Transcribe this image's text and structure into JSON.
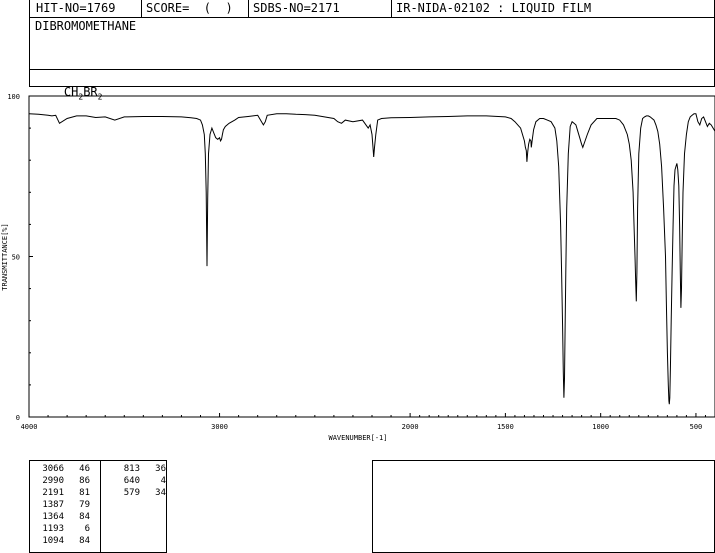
{
  "header": {
    "hit_no": "HIT-NO=1769",
    "score": "SCORE=  (  )",
    "sdbs_no": "SDBS-NO=2171",
    "ir_id": "IR-NIDA-02102 : LIQUID FILM",
    "compound_name": "DIBROMOMETHANE",
    "formula_pre": "CH",
    "formula_sub1": "2",
    "formula_mid": "BR",
    "formula_sub2": "2"
  },
  "chart_data": {
    "type": "line",
    "xlabel": "WAVENUMBER[-1]",
    "ylabel": "TRANSMITTANCE[%]",
    "xlim": [
      4000,
      400
    ],
    "ylim": [
      0,
      100
    ],
    "x_ticks": [
      4000,
      3000,
      2000,
      1500,
      1000,
      500
    ],
    "x_tick_labels": [
      "4000",
      "3000",
      "2000",
      "1500",
      "1000",
      "500"
    ],
    "y_ticks": [
      0,
      50,
      100
    ],
    "y_tick_labels": [
      "0",
      "50",
      "100"
    ],
    "x": [
      4000,
      3950,
      3900,
      3880,
      3860,
      3840,
      3800,
      3750,
      3700,
      3650,
      3600,
      3550,
      3500,
      3400,
      3300,
      3200,
      3150,
      3120,
      3100,
      3090,
      3080,
      3075,
      3070,
      3066,
      3062,
      3058,
      3050,
      3040,
      3030,
      3020,
      3010,
      3000,
      2995,
      2990,
      2985,
      2980,
      2970,
      2950,
      2920,
      2900,
      2850,
      2800,
      2780,
      2770,
      2760,
      2750,
      2700,
      2650,
      2600,
      2550,
      2500,
      2450,
      2400,
      2380,
      2360,
      2340,
      2300,
      2250,
      2220,
      2210,
      2200,
      2195,
      2191,
      2187,
      2180,
      2170,
      2150,
      2100,
      2000,
      1900,
      1800,
      1700,
      1600,
      1500,
      1470,
      1450,
      1420,
      1400,
      1395,
      1390,
      1387,
      1383,
      1378,
      1372,
      1366,
      1364,
      1360,
      1352,
      1340,
      1320,
      1300,
      1280,
      1260,
      1240,
      1230,
      1220,
      1210,
      1205,
      1200,
      1196,
      1193,
      1190,
      1187,
      1183,
      1178,
      1170,
      1160,
      1150,
      1140,
      1130,
      1120,
      1110,
      1100,
      1094,
      1085,
      1070,
      1050,
      1020,
      1000,
      980,
      960,
      940,
      920,
      900,
      880,
      860,
      850,
      840,
      830,
      825,
      820,
      816,
      813,
      810,
      806,
      800,
      790,
      780,
      770,
      760,
      750,
      740,
      730,
      720,
      710,
      700,
      690,
      680,
      670,
      660,
      655,
      650,
      645,
      642,
      640,
      637,
      634,
      630,
      625,
      620,
      615,
      610,
      605,
      600,
      595,
      590,
      586,
      582,
      579,
      576,
      572,
      568,
      560,
      550,
      540,
      530,
      520,
      510,
      500,
      490,
      480,
      470,
      460,
      450,
      440,
      430,
      420,
      410,
      400
    ],
    "y": [
      94.5,
      94.3,
      94.0,
      93.8,
      94.0,
      91.5,
      93.0,
      93.8,
      93.8,
      93.3,
      93.5,
      92.5,
      93.5,
      93.6,
      93.6,
      93.5,
      93.2,
      93.0,
      92.5,
      91.0,
      88.0,
      82.0,
      70.0,
      47.0,
      68.0,
      82.0,
      88.0,
      90.0,
      88.5,
      87.0,
      86.5,
      87.0,
      86.0,
      86.5,
      88.0,
      89.5,
      90.5,
      91.5,
      92.5,
      93.3,
      93.6,
      94.0,
      92.0,
      91.0,
      92.0,
      94.0,
      94.5,
      94.5,
      94.3,
      94.2,
      94.0,
      93.5,
      93.0,
      92.0,
      91.5,
      92.5,
      92.0,
      92.5,
      90.0,
      91.0,
      88.0,
      84.0,
      81.0,
      84.0,
      88.0,
      92.5,
      93.0,
      93.2,
      93.3,
      93.5,
      93.6,
      93.8,
      93.8,
      93.5,
      93.0,
      92.0,
      90.0,
      86.0,
      84.0,
      83.0,
      79.5,
      82.5,
      85.0,
      86.5,
      86.0,
      84.0,
      86.0,
      89.5,
      92.0,
      93.0,
      93.0,
      92.5,
      92.0,
      90.0,
      86.0,
      78.0,
      60.0,
      45.0,
      28.0,
      14.0,
      6.0,
      12.0,
      25.0,
      45.0,
      65.0,
      82.0,
      90.5,
      92.0,
      91.5,
      91.0,
      89.0,
      87.0,
      85.0,
      84.0,
      85.5,
      88.0,
      91.0,
      93.0,
      93.0,
      93.0,
      93.0,
      93.0,
      93.0,
      92.5,
      91.0,
      88.0,
      85.0,
      80.0,
      70.0,
      60.0,
      50.0,
      42.0,
      36.0,
      45.0,
      65.0,
      82.0,
      90.0,
      93.0,
      93.5,
      93.8,
      93.8,
      93.5,
      93.0,
      92.5,
      91.0,
      89.0,
      85.0,
      78.0,
      65.0,
      50.0,
      35.0,
      20.0,
      10.0,
      5.0,
      4.0,
      6.0,
      15.0,
      30.0,
      45.0,
      60.0,
      72.0,
      77.0,
      78.0,
      79.0,
      77.0,
      72.0,
      60.0,
      45.0,
      34.0,
      40.0,
      55.0,
      70.0,
      82.0,
      88.0,
      92.0,
      93.5,
      94.0,
      94.5,
      94.5,
      92.0,
      91.0,
      93.0,
      93.5,
      92.0,
      90.5,
      91.5,
      91.0,
      90.0,
      89.0
    ]
  },
  "peak_table": {
    "col1": [
      [
        "3066",
        "46"
      ],
      [
        "2990",
        "86"
      ],
      [
        "2191",
        "81"
      ],
      [
        "1387",
        "79"
      ],
      [
        "1364",
        "84"
      ],
      [
        "1193",
        "6"
      ],
      [
        "1094",
        "84"
      ]
    ],
    "col2": [
      [
        "813",
        "36"
      ],
      [
        "640",
        "4"
      ],
      [
        "579",
        "34"
      ]
    ]
  }
}
